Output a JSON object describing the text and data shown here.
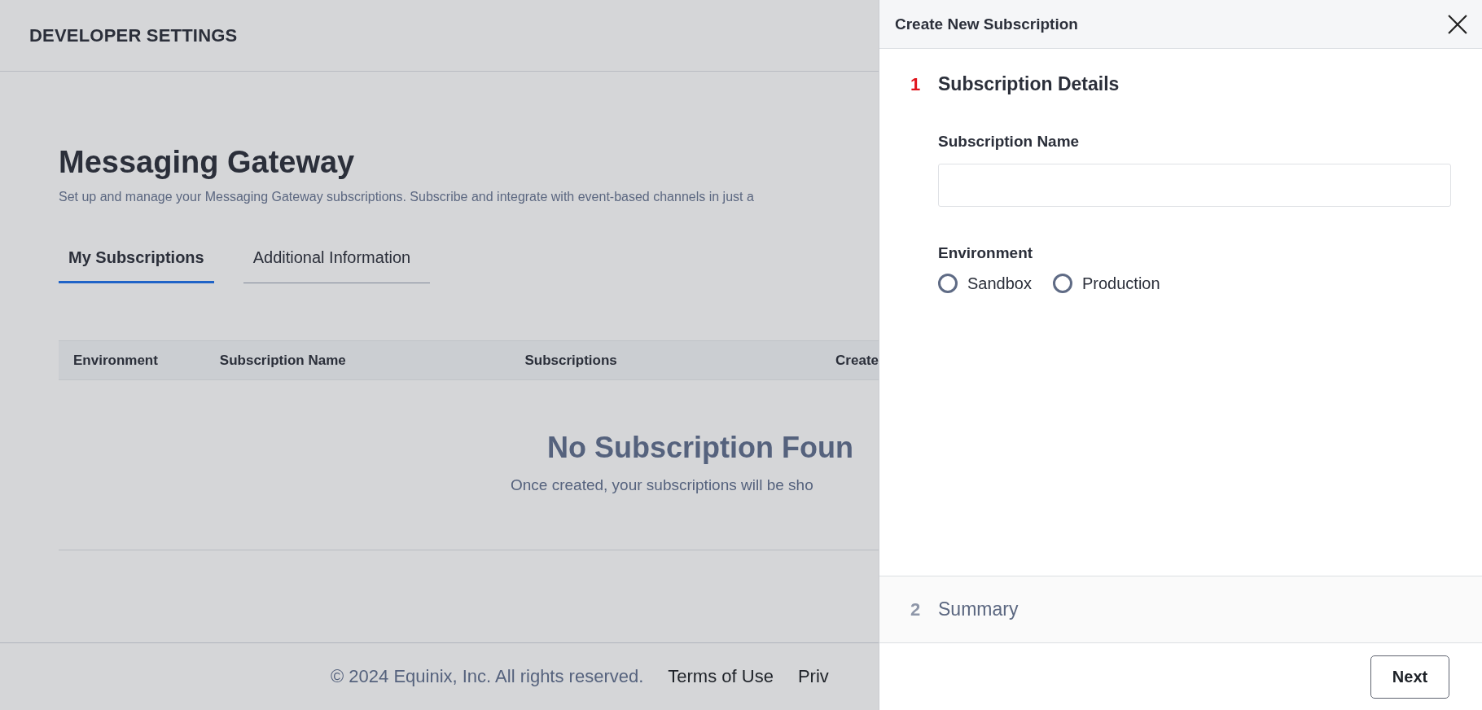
{
  "header": {
    "title": "DEVELOPER SETTINGS"
  },
  "page": {
    "title": "Messaging Gateway",
    "description": "Set up and manage your Messaging Gateway subscriptions. Subscribe and integrate with event-based channels in just a"
  },
  "tabs": [
    {
      "label": "My Subscriptions",
      "selected": true
    },
    {
      "label": "Additional Information",
      "selected": false
    }
  ],
  "table": {
    "columns": [
      "Environment",
      "Subscription Name",
      "Subscriptions",
      "Create"
    ],
    "empty_state": {
      "title": "No Subscription Foun",
      "message": "Once created, your subscriptions will be sho"
    }
  },
  "footer": {
    "copyright": "© 2024 Equinix, Inc. All rights reserved.",
    "links": [
      "Terms of Use",
      "Priv"
    ]
  },
  "drawer": {
    "title": "Create New Subscription",
    "steps": [
      {
        "number": "1",
        "title": "Subscription Details",
        "selected": true
      },
      {
        "number": "2",
        "title": "Summary",
        "selected": false
      }
    ],
    "fields": [
      {
        "kind": "text",
        "label": "Subscription Name"
      },
      {
        "kind": "radio",
        "label": "Environment",
        "options": [
          {
            "label": "Sandbox",
            "selected": false
          },
          {
            "label": "Production",
            "selected": false
          }
        ]
      }
    ],
    "buttons": [
      "Next"
    ]
  }
}
